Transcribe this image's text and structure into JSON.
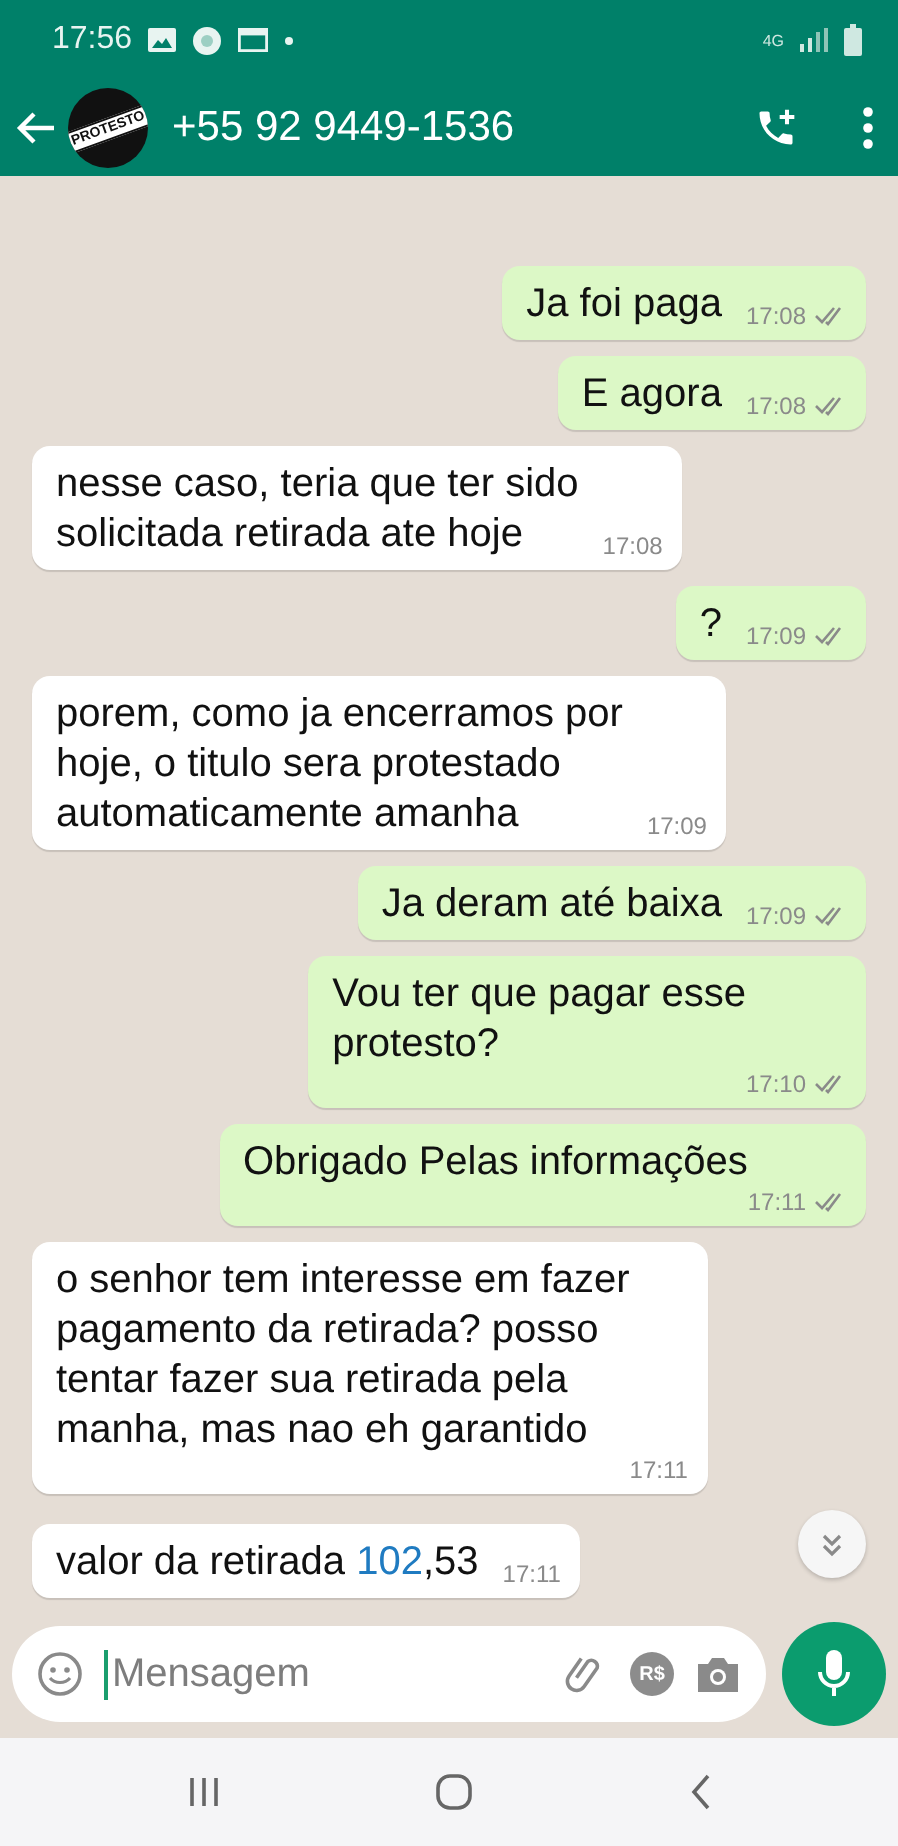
{
  "status_bar": {
    "time": "17:56",
    "network": "4G"
  },
  "header": {
    "contact": "+55 92 9449-1536",
    "avatar_label": "PROTESTO"
  },
  "messages": [
    {
      "kind": "out",
      "segments": [
        {
          "text": "Ja foi paga"
        }
      ],
      "time": "17:08",
      "read": false
    },
    {
      "kind": "out",
      "segments": [
        {
          "text": "E agora"
        }
      ],
      "time": "17:08",
      "read": false
    },
    {
      "kind": "in",
      "segments": [
        {
          "text": "nesse caso, teria que ter sido\nsolicitada retirada ate hoje"
        }
      ],
      "time": "17:08"
    },
    {
      "kind": "out",
      "segments": [
        {
          "text": "?"
        }
      ],
      "time": "17:09",
      "read": false
    },
    {
      "kind": "in",
      "segments": [
        {
          "text": "porem, como ja encerramos por\nhoje, o titulo sera protestado\nautomaticamente amanha"
        }
      ],
      "time": "17:09"
    },
    {
      "kind": "out",
      "segments": [
        {
          "text": "Ja deram até baixa"
        }
      ],
      "time": "17:09",
      "read": false
    },
    {
      "kind": "out",
      "segments": [
        {
          "text": "Vou ter que pagar esse\nprotesto?"
        }
      ],
      "time": "17:10",
      "read": false,
      "time_below": true
    },
    {
      "kind": "out",
      "segments": [
        {
          "text": "Obrigado Pelas informações"
        }
      ],
      "time": "17:11",
      "read": false,
      "time_below": true
    },
    {
      "kind": "in",
      "segments": [
        {
          "text": "o senhor tem interesse em fazer\npagamento da retirada? posso\ntentar fazer sua retirada pela\nmanha, mas nao eh garantido"
        }
      ],
      "time": "17:11",
      "time_below": true
    },
    {
      "kind": "in",
      "segments": [
        {
          "text": "valor da retirada "
        },
        {
          "text": "102",
          "link": true
        },
        {
          "text": ",53"
        }
      ],
      "time": "17:11"
    }
  ],
  "composer": {
    "placeholder": "Mensagem",
    "currency_label": "R$"
  }
}
